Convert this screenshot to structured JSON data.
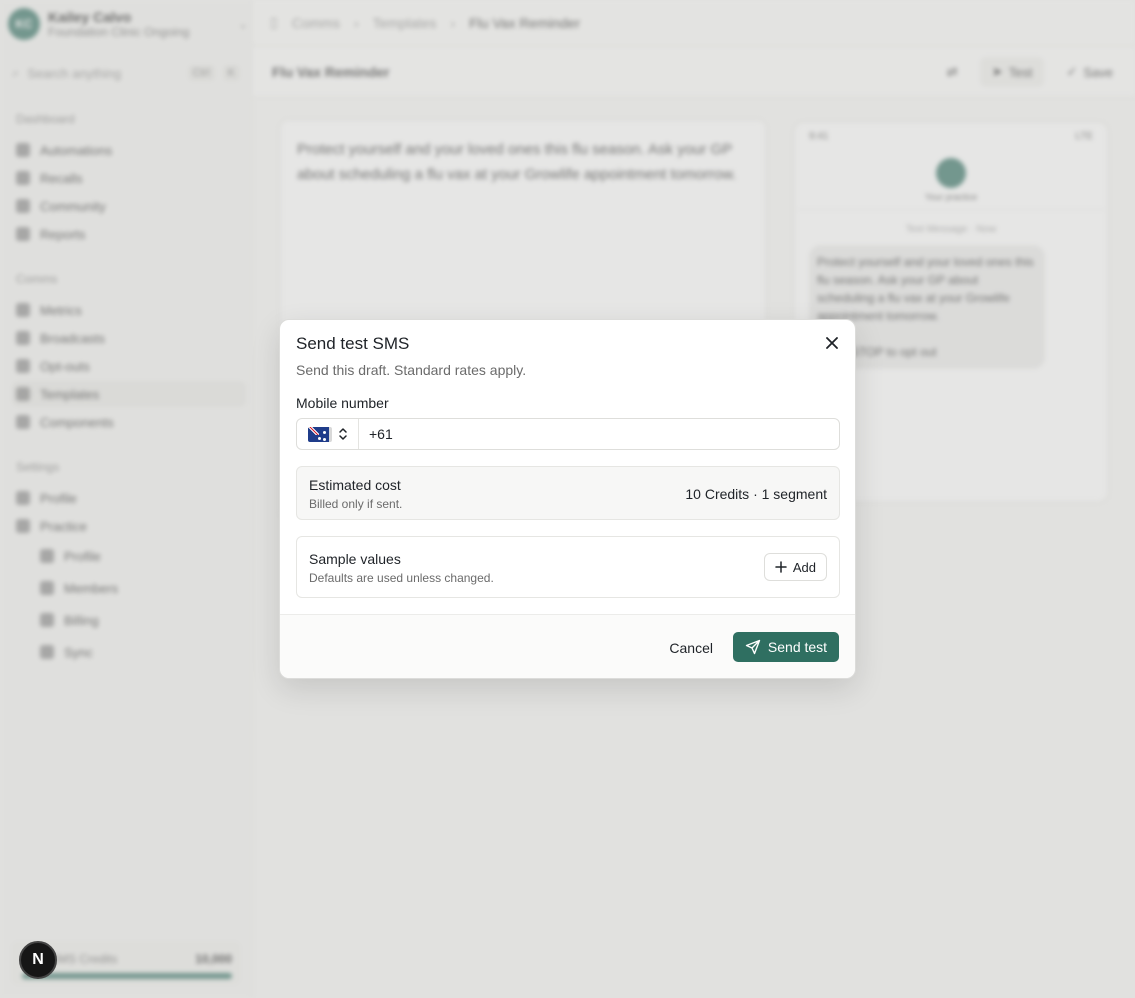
{
  "app": {
    "org_initials": "KC",
    "org_name": "Kailey Calvo",
    "org_sub": "Foundation Clinic Ongoing",
    "search_placeholder": "Search anything",
    "search_kbd": "Ctrl",
    "search_kbd2": "K",
    "sections": {
      "dashboard": "Dashboard",
      "comms": "Comms",
      "settings": "Settings"
    },
    "nav_dashboard": [
      "Automations",
      "Recalls",
      "Community",
      "Reports"
    ],
    "nav_comms": [
      "Metrics",
      "Broadcasts",
      "Opt-outs",
      "Templates",
      "Components"
    ],
    "nav_settings": [
      "Profile",
      "Practice"
    ],
    "nav_practice_sub": [
      "Profile",
      "Members",
      "Billing",
      "Sync"
    ],
    "credits_label": "SMS Credits",
    "credits_value": "10,000",
    "breadcrumbs": [
      "Comms",
      "Templates",
      "Flu Vax Reminder"
    ],
    "toolbar_title": "Flu Vax Reminder",
    "toolbar_test": "Test",
    "toolbar_save": "Save",
    "editor_text": "Protect yourself and your loved ones this flu season. Ask your GP about scheduling a flu vax at your Growlife appointment tomorrow.",
    "phone_time": "9:41",
    "phone_status": "LTE",
    "phone_contact": "Your practice",
    "phone_date": "Text Message · Now",
    "bubble_text": "Protect yourself and your loved ones this flu season. Ask your GP about scheduling a flu vax at your Growlife appointment tomorrow.",
    "bubble_optout": "Reply STOP to opt out"
  },
  "dialog": {
    "title": "Send test SMS",
    "subtitle": "Send this draft. Standard rates apply.",
    "mobile_label": "Mobile number",
    "country": "AU",
    "mobile_value": "+61",
    "cost_title": "Estimated cost",
    "cost_sub": "Billed only if sent.",
    "cost_value": "10 Credits · 1 segment",
    "sample_title": "Sample values",
    "sample_sub": "Defaults are used unless changed.",
    "add_label": "Add",
    "cancel_label": "Cancel",
    "send_label": "Send test"
  },
  "badge": {
    "letter": "N"
  },
  "colors": {
    "accent": "#2f6f61",
    "overlay": "#c8c8c6"
  },
  "icons": [
    "close-icon",
    "plus-icon",
    "send-icon",
    "chevron-updown-icon",
    "au-flag-icon"
  ]
}
